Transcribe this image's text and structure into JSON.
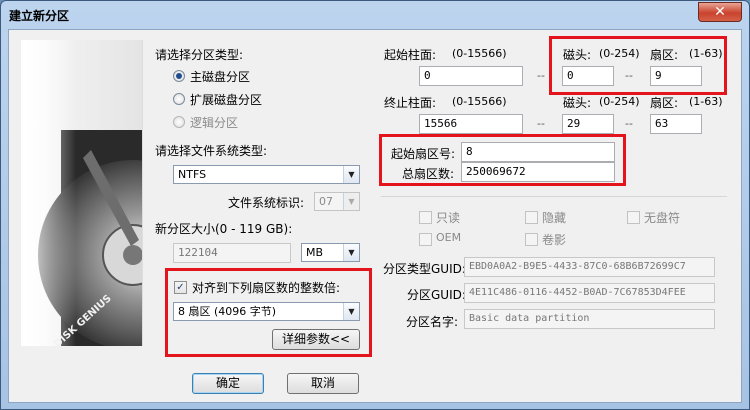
{
  "window": {
    "title": "建立新分区",
    "close_glyph": "✕"
  },
  "art": {
    "brand": "DISK GENIUS"
  },
  "partition_type": {
    "label": "请选择分区类型:",
    "options": [
      "主磁盘分区",
      "扩展磁盘分区",
      "逻辑分区"
    ],
    "selected": 0
  },
  "filesystem": {
    "label": "请选择文件系统类型:",
    "value": "NTFS",
    "id_label": "文件系统标识:",
    "id_value": "07"
  },
  "size": {
    "label": "新分区大小(0 - 119 GB):",
    "value": "122104",
    "unit": "MB"
  },
  "align": {
    "checkbox_label": "对齐到下列扇区数的整数倍:",
    "checked": true,
    "value": "8 扇区 (4096 字节)",
    "details_button": "详细参数<<"
  },
  "start": {
    "cyl_label": "起始柱面:",
    "cyl_range": "(0-15566)",
    "cyl_value": "0",
    "head_label": "磁头:",
    "head_range": "(0-254)",
    "head_value": "0",
    "sector_label": "扇区:",
    "sector_range": "(1-63)",
    "sector_value": "9"
  },
  "end": {
    "cyl_label": "终止柱面:",
    "cyl_range": "(0-15566)",
    "cyl_value": "15566",
    "head_label": "磁头:",
    "head_range": "(0-254)",
    "head_value": "29",
    "sector_label": "扇区:",
    "sector_range": "(1-63)",
    "sector_value": "63"
  },
  "sep": "--",
  "lba": {
    "start_label": "起始扇区号:",
    "start_value": "8",
    "total_label": "总扇区数:",
    "total_value": "250069672"
  },
  "attributes": {
    "readonly": "只读",
    "hidden": "隐藏",
    "no_drive_letter": "无盘符",
    "oem": "OEM",
    "shadow": "卷影"
  },
  "gpt": {
    "type_guid_label": "分区类型GUID:",
    "type_guid_value": "EBD0A0A2-B9E5-4433-87C0-68B6B72699C7",
    "guid_label": "分区GUID:",
    "guid_value": "4E11C486-0116-4452-B0AD-7C67853D4FEE",
    "name_label": "分区名字:",
    "name_value": "Basic data partition"
  },
  "buttons": {
    "ok": "确定",
    "cancel": "取消"
  },
  "colors": {
    "highlight": "#e3141c",
    "title_bar": "#a7c3e4"
  }
}
